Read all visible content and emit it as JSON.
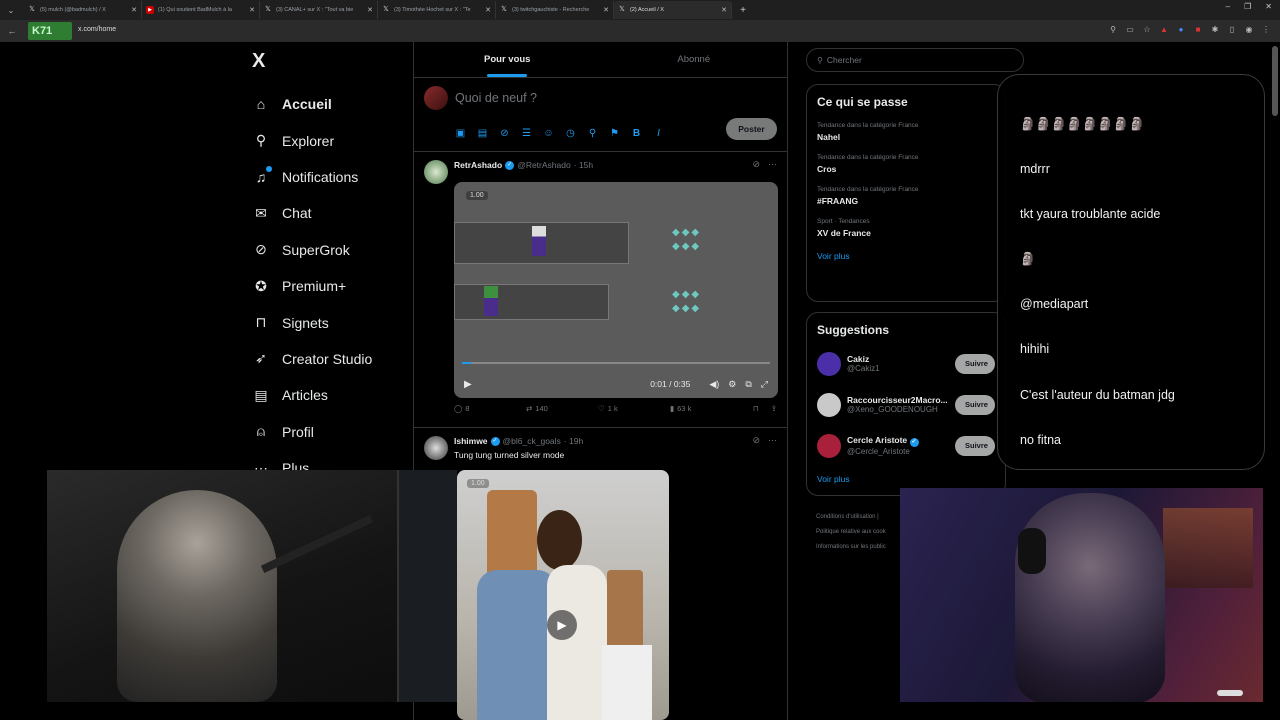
{
  "browser": {
    "tabs": [
      {
        "title": "(5) mulch (@badmulch) / X",
        "favicon": "x-icon",
        "active": false
      },
      {
        "title": "(1) Qui soutient BadMulch à la",
        "favicon": "youtube-icon",
        "active": false
      },
      {
        "title": "(3) CANAL+ sur X : \"Tout va bie",
        "favicon": "x-icon",
        "active": false
      },
      {
        "title": "(3) Timothée Hochet sur X : \"Te",
        "favicon": "x-icon",
        "active": false
      },
      {
        "title": "(3) twitchgauchiste - Recherche",
        "favicon": "x-icon",
        "active": false
      },
      {
        "title": "(2) Accueil / X",
        "favicon": "x-icon",
        "active": true
      }
    ],
    "url": "x.com/home",
    "channel_logo": "K71"
  },
  "sidebar": {
    "logo": "X",
    "items": [
      {
        "label": "Accueil",
        "icon": "home-icon",
        "glyph": "⌂"
      },
      {
        "label": "Explorer",
        "icon": "search-icon",
        "glyph": "⚲"
      },
      {
        "label": "Notifications",
        "icon": "bell-icon",
        "glyph": "♫"
      },
      {
        "label": "Chat",
        "icon": "mail-icon",
        "glyph": "✉"
      },
      {
        "label": "SuperGrok",
        "icon": "grok-icon",
        "glyph": "⊘"
      },
      {
        "label": "Premium+",
        "icon": "premium-icon",
        "glyph": "✪"
      },
      {
        "label": "Signets",
        "icon": "bookmark-icon",
        "glyph": "⊓"
      },
      {
        "label": "Creator Studio",
        "icon": "rocket-icon",
        "glyph": "➶"
      },
      {
        "label": "Articles",
        "icon": "article-icon",
        "glyph": "▤"
      },
      {
        "label": "Profil",
        "icon": "person-icon",
        "glyph": "⍝"
      },
      {
        "label": "Plus",
        "icon": "more-icon",
        "glyph": "⋯"
      }
    ]
  },
  "feed": {
    "tabs": [
      "Pour vous",
      "Abonné"
    ],
    "composer_placeholder": "Quoi de neuf ?",
    "post_label": "Poster",
    "tweet1": {
      "name": "RetrAshado",
      "handle": "@RetrAshado",
      "time": "· 15h",
      "badge": "1.00",
      "video_time": "0:01 / 0:35",
      "progress": 0.03,
      "replies": "8",
      "reposts": "140",
      "likes": "1 k",
      "views": "63 k"
    },
    "tweet2": {
      "name": "Ishimwe",
      "handle": "@bl6_ck_goals",
      "time": "· 19h",
      "text": "Tung tung turned silver mode",
      "badge": "1.00"
    }
  },
  "right": {
    "search_placeholder": "Chercher",
    "trends_title": "Ce qui se passe",
    "trends": [
      {
        "category": "Tendance dans la catégorie France",
        "tag": "Nahel"
      },
      {
        "category": "Tendance dans la catégorie France",
        "tag": "Cros"
      },
      {
        "category": "Tendance dans la catégorie France",
        "tag": "#FRAANG"
      },
      {
        "category": "Sport · Tendances",
        "tag": "XV de France"
      }
    ],
    "see_more": "Voir plus",
    "suggestions_title": "Suggestions",
    "suggestions": [
      {
        "name": "Cakiz",
        "handle": "@Cakiz1",
        "verified": false,
        "color": "#4a2fa8"
      },
      {
        "name": "Raccourcisseur2Macro...",
        "handle": "@Xeno_GOODENOUGH",
        "verified": false,
        "color": "#c9c9c9"
      },
      {
        "name": "Cercle Aristote",
        "handle": "@Cercle_Aristote",
        "verified": true,
        "color": "#a8203a"
      }
    ],
    "follow_label": "Suivre",
    "footer": [
      "Conditions d'utilisation |",
      "Politique relative aux cook",
      "Informations sur les public"
    ]
  },
  "chat": {
    "messages": [
      {
        "text": "🗿🗿🗿🗿🗿🗿🗿🗿"
      },
      {
        "text": "mdrrr"
      },
      {
        "text": "tkt yaura troublante acide"
      },
      {
        "text": "🗿"
      },
      {
        "text": "@mediapart"
      },
      {
        "text": "hihihi"
      },
      {
        "text": "C'est l'auteur du batman jdg"
      },
      {
        "text": "no fitna"
      }
    ]
  },
  "colors": {
    "accent": "#1d9bf0",
    "background": "#000000",
    "border": "#2f3336",
    "muted_text": "#71767b"
  }
}
